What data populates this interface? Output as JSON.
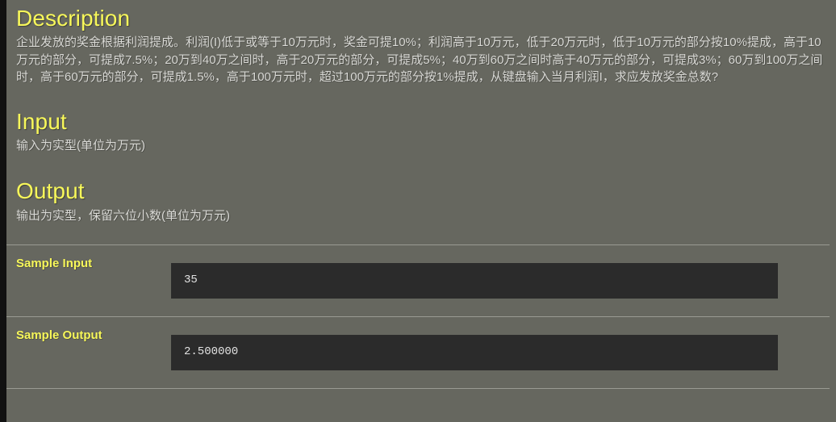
{
  "problem": {
    "description": {
      "heading": "Description",
      "body": "企业发放的奖金根据利润提成。利润(I)低于或等于10万元时，奖金可提10%；利润高于10万元，低于20万元时，低于10万元的部分按10%提成，高于10万元的部分，可提成7.5%；20万到40万之间时，高于20万元的部分，可提成5%；40万到60万之间时高于40万元的部分，可提成3%；60万到100万之间时，高于60万元的部分，可提成1.5%，高于100万元时，超过100万元的部分按1%提成，从键盘输入当月利润I，求应发放奖金总数?"
    },
    "input": {
      "heading": "Input",
      "body": "输入为实型(单位为万元)"
    },
    "output": {
      "heading": "Output",
      "body": "输出为实型，保留六位小数(单位为万元)"
    },
    "samples": [
      {
        "label": "Sample Input",
        "value": "35"
      },
      {
        "label": "Sample Output",
        "value": "2.500000"
      }
    ]
  },
  "colors": {
    "page_background": "#66675f",
    "heading_yellow": "#f7f75a",
    "body_text": "#dadad6",
    "code_box_background": "#2b2b2b",
    "code_text": "#e2e2e2",
    "divider": "#9a9b93",
    "left_strip": "#111111"
  }
}
